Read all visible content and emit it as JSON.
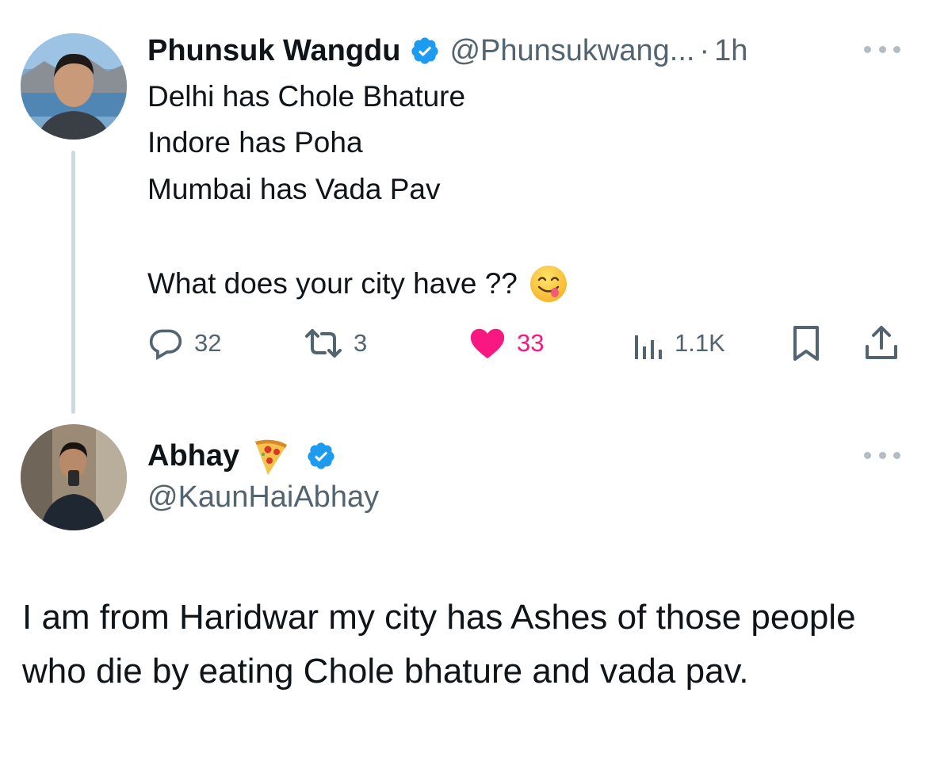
{
  "tweet1": {
    "author_name": "Phunsuk Wangdu",
    "author_handle": "@Phunsukwang...",
    "separator": "·",
    "time": "1h",
    "lines": [
      "Delhi has Chole Bhature",
      "Indore has Poha",
      "Mumbai has Vada Pav",
      "What does your city have ??"
    ],
    "emoji_icon": "yum-face-emoji",
    "stats": {
      "replies": "32",
      "retweets": "3",
      "likes": "33",
      "views": "1.1K"
    },
    "liked": true
  },
  "tweet2": {
    "author_name": "Abhay",
    "name_emoji_icon": "pizza-emoji",
    "author_handle": "@KaunHaiAbhay",
    "text": "I am from Haridwar my city has Ashes of those people who die by eating Chole bhature and vada pav."
  },
  "colors": {
    "verified": "#1d9bf0",
    "like": "#f91880",
    "secondary_text": "#536471",
    "thread_line": "#cfd9de"
  }
}
